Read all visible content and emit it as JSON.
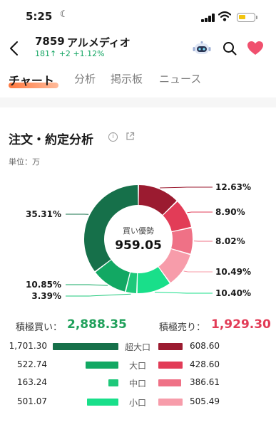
{
  "status_bar": {
    "time": "5:25",
    "moon": "☾"
  },
  "header": {
    "stock_code": "7859",
    "stock_name": "アルメディオ",
    "price": "181",
    "change_arrow": "↑",
    "change": "+2",
    "change_pct": "+1.12%",
    "icons": [
      "back-arrow-icon",
      "robot-icon",
      "search-icon",
      "heart-icon"
    ]
  },
  "tabs": [
    {
      "label": "チャート",
      "active": true
    },
    {
      "label": "分析",
      "active": false
    },
    {
      "label": "掲示板",
      "active": false
    },
    {
      "label": "ニュース",
      "active": false
    }
  ],
  "section": {
    "title": "注文・約定分析",
    "info_glyph": "i",
    "unit": "単位：万"
  },
  "chart_data": {
    "type": "pie",
    "donut": true,
    "center_label": "買い優勢",
    "center_value": "959.05",
    "slices": [
      {
        "label": "超大口 売り",
        "value": 12.63,
        "text": "12.63%",
        "color": "#9b1b30"
      },
      {
        "label": "大口 売り",
        "value": 8.9,
        "text": "8.90%",
        "color": "#e23c57"
      },
      {
        "label": "中口 売り",
        "value": 8.02,
        "text": "8.02%",
        "color": "#ef7186"
      },
      {
        "label": "小口 売り",
        "value": 10.49,
        "text": "10.49%",
        "color": "#f79caa"
      },
      {
        "label": "小口 買い",
        "value": 10.4,
        "text": "10.40%",
        "color": "#19df8a"
      },
      {
        "label": "中口 買い",
        "value": 3.39,
        "text": "3.39%",
        "color": "#1ec87a"
      },
      {
        "label": "大口 買い",
        "value": 10.85,
        "text": "10.85%",
        "color": "#12a863"
      },
      {
        "label": "超大口 買い",
        "value": 35.31,
        "text": "35.31%",
        "color": "#16704a"
      }
    ]
  },
  "totals": {
    "buy_label": "積極買い：",
    "buy_value": "2,888.35",
    "sell_label": "積極売り：",
    "sell_value": "1,929.30"
  },
  "breakdown": [
    {
      "name": "超大口",
      "buy": "1,701.30",
      "sell": "608.60",
      "buy_value": 1701.3,
      "sell_value": 608.6,
      "buy_color": "#16704a",
      "sell_color": "#9b1b30"
    },
    {
      "name": "大口",
      "buy": "522.74",
      "sell": "428.60",
      "buy_value": 522.74,
      "sell_value": 428.6,
      "buy_color": "#12a863",
      "sell_color": "#e23c57"
    },
    {
      "name": "中口",
      "buy": "163.24",
      "sell": "386.61",
      "buy_value": 163.24,
      "sell_value": 386.61,
      "buy_color": "#1ec87a",
      "sell_color": "#ef7186"
    },
    {
      "name": "小口",
      "buy": "501.07",
      "sell": "505.49",
      "buy_value": 501.07,
      "sell_value": 505.49,
      "buy_color": "#19df8a",
      "sell_color": "#f79caa"
    }
  ],
  "colors": {
    "buy_accent": "#1fa05a",
    "sell_accent": "#e23c57",
    "tab_underline": "#ff6a2a"
  }
}
